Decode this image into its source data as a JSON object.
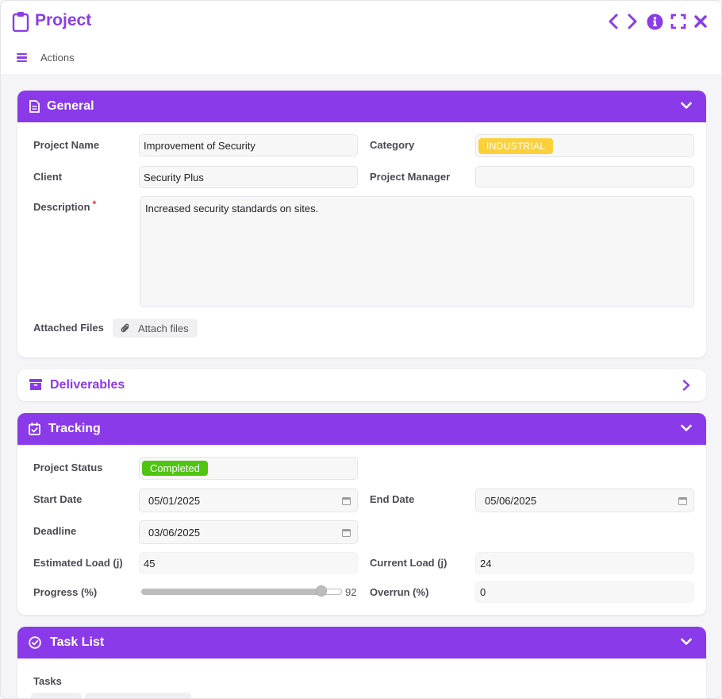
{
  "window": {
    "title": "Project",
    "actions_label": "Actions",
    "accent": "#8a3ae8"
  },
  "general": {
    "title": "General",
    "project_name_label": "Project Name",
    "project_name_value": "Improvement of Security",
    "category_label": "Category",
    "category_value": "INDUSTRIAL",
    "client_label": "Client",
    "client_value": "Security Plus",
    "project_manager_label": "Project Manager",
    "project_manager_value": "",
    "description_label": "Description",
    "description_required": "*",
    "description_value": "Increased security standards on sites.",
    "attached_files_label": "Attached Files",
    "attach_button_label": "Attach files"
  },
  "deliverables": {
    "title": "Deliverables"
  },
  "tracking": {
    "title": "Tracking",
    "project_status_label": "Project Status",
    "project_status_value": "Completed",
    "start_date_label": "Start Date",
    "start_date_value": "05/01/2025",
    "end_date_label": "End Date",
    "end_date_value": "05/06/2025",
    "deadline_label": "Deadline",
    "deadline_value": "03/06/2025",
    "estimated_load_label": "Estimated Load (j)",
    "estimated_load_value": "45",
    "current_load_label": "Current Load (j)",
    "current_load_value": "24",
    "progress_label": "Progress (%)",
    "progress_value": "92",
    "overrun_label": "Overrun (%)",
    "overrun_value": "0"
  },
  "task_list": {
    "title": "Task List",
    "tasks_label": "Tasks"
  },
  "colors": {
    "category_tag": "#fbd13b",
    "status_tag": "#4fc512",
    "required": "#e0322f"
  }
}
